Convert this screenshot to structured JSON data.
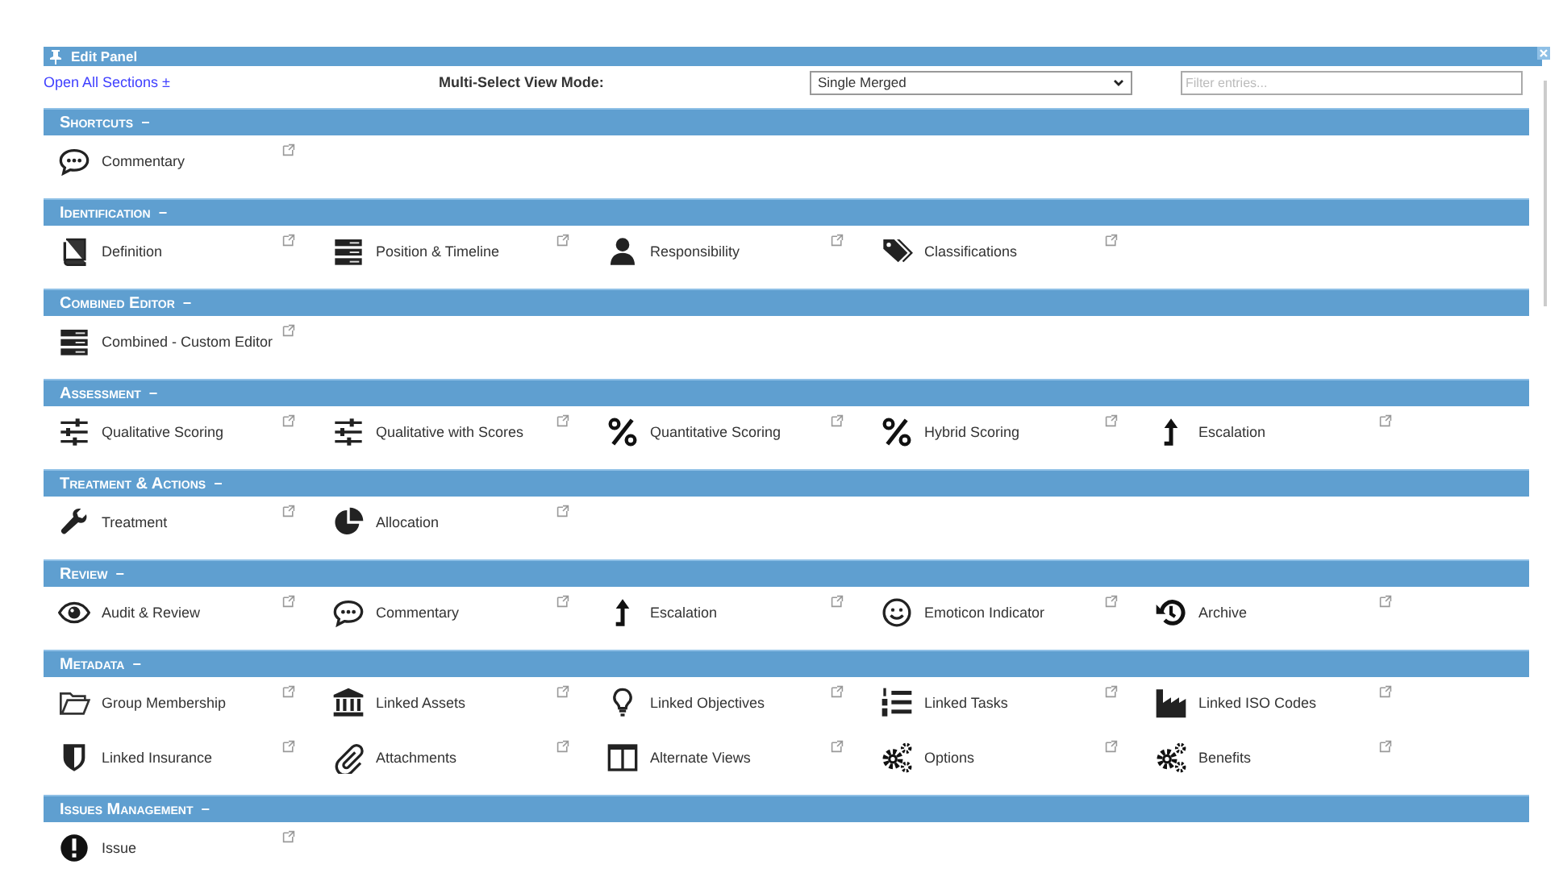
{
  "window": {
    "title": "Edit Panel"
  },
  "toolbar": {
    "open_all_link": "Open All Sections ±",
    "view_mode_label": "Multi-Select View Mode:",
    "view_mode_value": "Single Merged",
    "filter": {
      "placeholder": "Filter entries..."
    }
  },
  "sections": [
    {
      "title": "Shortcuts",
      "toggle": "−",
      "items": [
        {
          "label": "Commentary",
          "kind": "comment"
        }
      ]
    },
    {
      "title": "Identification",
      "toggle": "−",
      "items": [
        {
          "label": "Definition",
          "kind": "book"
        },
        {
          "label": "Position & Timeline",
          "kind": "server"
        },
        {
          "label": "Responsibility",
          "kind": "user"
        },
        {
          "label": "Classifications",
          "kind": "tags"
        }
      ]
    },
    {
      "title": "Combined Editor",
      "toggle": "−",
      "items": [
        {
          "label": "Combined - Custom Editor",
          "kind": "server"
        }
      ]
    },
    {
      "title": "Assessment",
      "toggle": "−",
      "items": [
        {
          "label": "Qualitative Scoring",
          "kind": "sliders"
        },
        {
          "label": "Qualitative with Scores",
          "kind": "sliders"
        },
        {
          "label": "Quantitative Scoring",
          "kind": "percent"
        },
        {
          "label": "Hybrid Scoring",
          "kind": "percent"
        },
        {
          "label": "Escalation",
          "kind": "levelup"
        }
      ]
    },
    {
      "title": "Treatment & Actions",
      "toggle": "−",
      "items": [
        {
          "label": "Treatment",
          "kind": "wrench"
        },
        {
          "label": "Allocation",
          "kind": "pie"
        }
      ]
    },
    {
      "title": "Review",
      "toggle": "−",
      "items": [
        {
          "label": "Audit & Review",
          "kind": "eye"
        },
        {
          "label": "Commentary",
          "kind": "comment"
        },
        {
          "label": "Escalation",
          "kind": "levelup"
        },
        {
          "label": "Emoticon Indicator",
          "kind": "smile"
        },
        {
          "label": "Archive",
          "kind": "history"
        }
      ]
    },
    {
      "title": "Metadata",
      "toggle": "−",
      "items": [
        {
          "label": "Group Membership",
          "kind": "folder"
        },
        {
          "label": "Linked Assets",
          "kind": "bank"
        },
        {
          "label": "Linked Objectives",
          "kind": "bulb"
        },
        {
          "label": "Linked Tasks",
          "kind": "listol"
        },
        {
          "label": "Linked ISO Codes",
          "kind": "industry"
        },
        {
          "label": "Linked Insurance",
          "kind": "shield"
        },
        {
          "label": "Attachments",
          "kind": "paperclip"
        },
        {
          "label": "Alternate Views",
          "kind": "columns"
        },
        {
          "label": "Options",
          "kind": "cogs"
        },
        {
          "label": "Benefits",
          "kind": "cogs"
        }
      ]
    },
    {
      "title": "Issues Management",
      "toggle": "−",
      "items": [
        {
          "label": "Issue",
          "kind": "exclamation"
        }
      ]
    }
  ]
}
